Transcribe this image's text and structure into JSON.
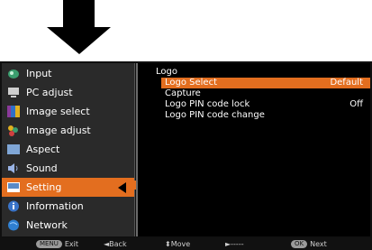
{
  "sidebar": {
    "items": [
      {
        "label": "Input",
        "icon": "input-icon",
        "color": "#3b9e6f"
      },
      {
        "label": "PC adjust",
        "icon": "pc-adjust-icon",
        "color": "#cfcfcf"
      },
      {
        "label": "Image select",
        "icon": "image-select-icon",
        "color": "#8a3a9a"
      },
      {
        "label": "Image adjust",
        "icon": "image-adjust-icon",
        "color": "#e0b020"
      },
      {
        "label": "Aspect",
        "icon": "aspect-icon",
        "color": "#7fa6d6"
      },
      {
        "label": "Sound",
        "icon": "sound-icon",
        "color": "#9ab4e6"
      },
      {
        "label": "Setting",
        "icon": "setting-icon",
        "color": "#5a8ac6",
        "selected": true
      },
      {
        "label": "Information",
        "icon": "information-icon",
        "color": "#3a74c8"
      },
      {
        "label": "Network",
        "icon": "network-icon",
        "color": "#2f7fd0"
      }
    ]
  },
  "panel": {
    "title": "Logo",
    "rows": [
      {
        "label": "Logo Select",
        "value": "Default",
        "active": true
      },
      {
        "label": "Capture",
        "value": ""
      },
      {
        "label": "Logo PIN code lock",
        "value": "Off"
      },
      {
        "label": "Logo PIN code change",
        "value": ""
      }
    ]
  },
  "footer": {
    "exit_key": "MENU",
    "exit": "Exit",
    "back": "◄Back",
    "move": "⬍Move",
    "next_symbol": "►-----",
    "ok_key": "OK",
    "next": "Next"
  },
  "colors": {
    "accent": "#e36e1f",
    "sidebar_bg": "#2a2a2a",
    "panel_bg": "#000000"
  }
}
